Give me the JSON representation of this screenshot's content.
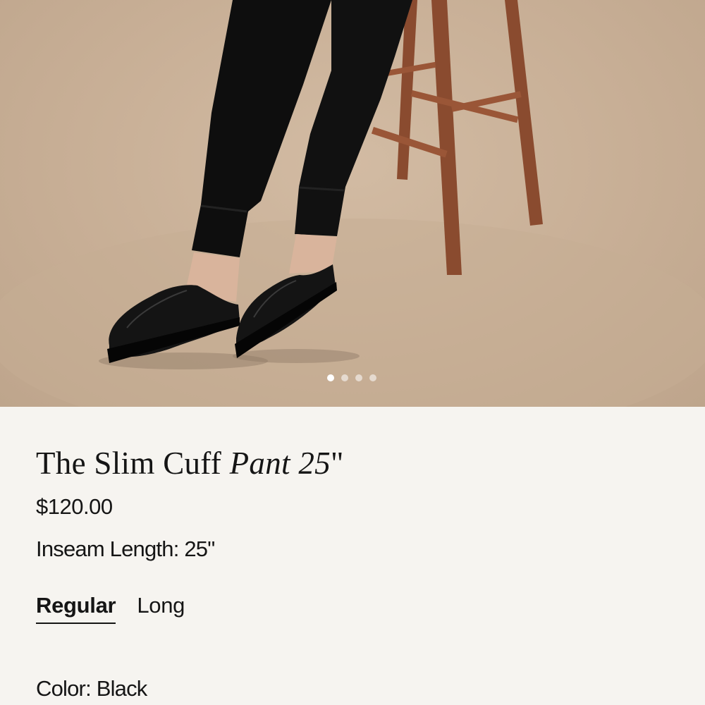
{
  "gallery": {
    "image_alt": "Model in black jogger pants and black leather mules, seated on wooden stool",
    "dot_count": 4,
    "active_index": 0
  },
  "product": {
    "title_roman": "The Slim Cuff ",
    "title_italic": "Pant 25",
    "title_suffix": "\"",
    "price": "$120.00",
    "inseam_label": "Inseam Length: 25\"",
    "length_options": [
      "Regular",
      "Long"
    ],
    "length_selected": "Regular",
    "color_label": "Color: Black"
  }
}
